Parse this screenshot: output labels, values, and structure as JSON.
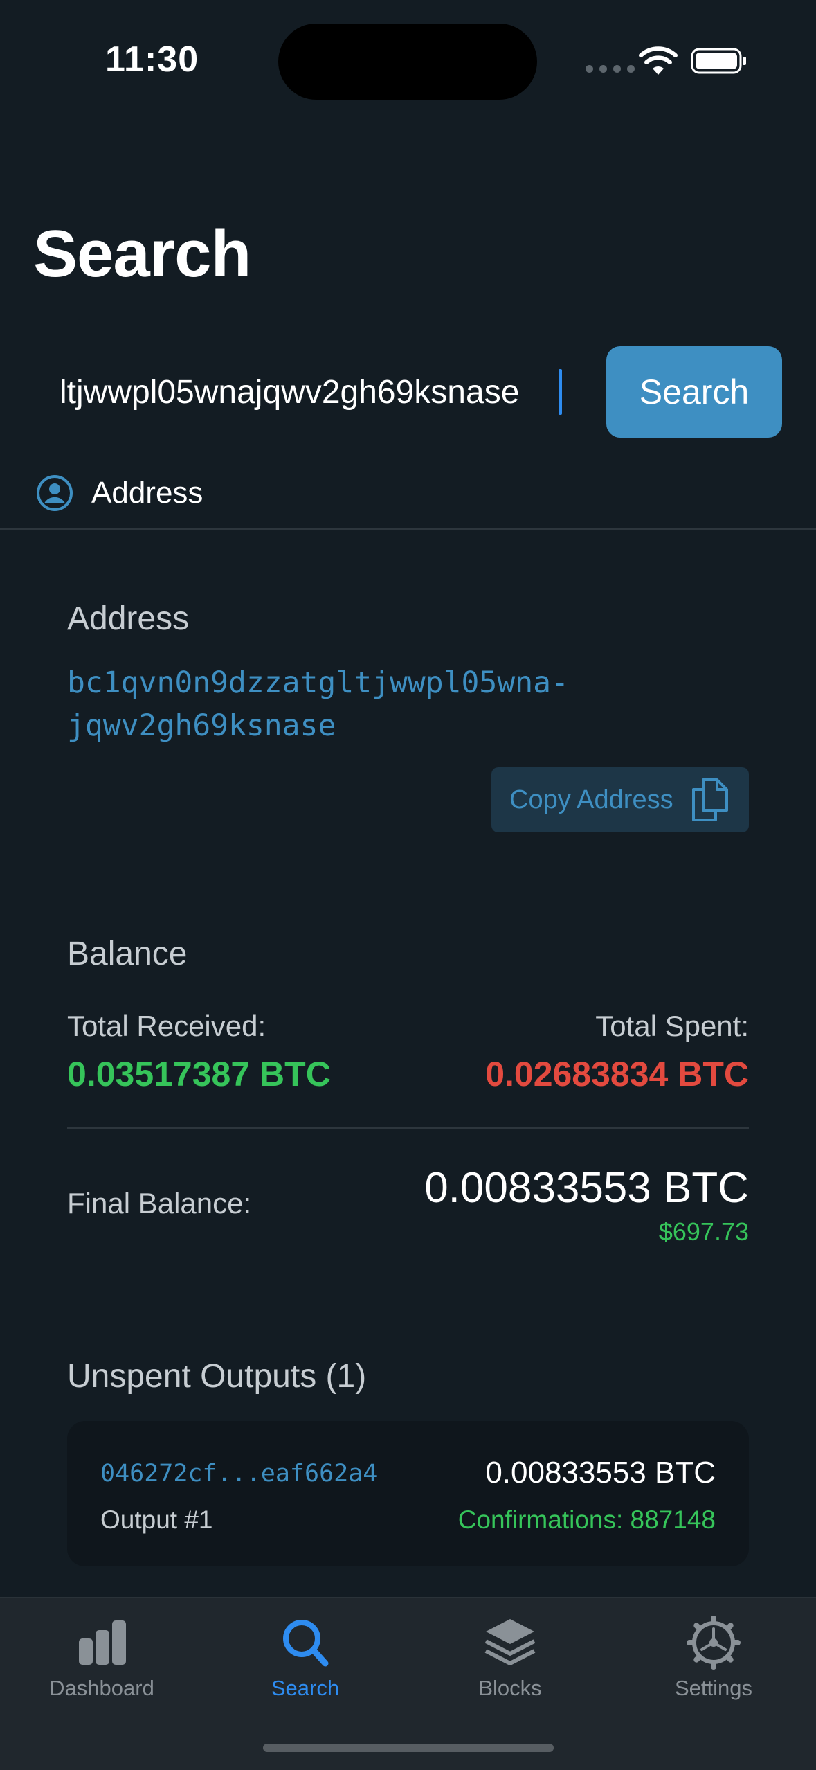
{
  "status_bar": {
    "time": "11:30"
  },
  "header": {
    "title": "Search"
  },
  "search": {
    "query": "ltjwwpl05wnajqwv2gh69ksnase",
    "button_label": "Search"
  },
  "result_type": {
    "icon": "person-circle-icon",
    "label": "Address"
  },
  "address_section": {
    "heading": "Address",
    "line1": "bc1qvn0n9dzzatgltjwwpl05wna-",
    "line2": "jqwv2gh69ksnase",
    "copy_label": "Copy Address",
    "copy_icon": "copy-icon"
  },
  "balance_section": {
    "heading": "Balance",
    "received_label": "Total Received:",
    "received_value": "0.03517387 BTC",
    "spent_label": "Total Spent:",
    "spent_value": "0.02683834 BTC",
    "final_label": "Final Balance:",
    "final_value": "0.00833553 BTC",
    "final_fiat": "$697.73"
  },
  "utxo_section": {
    "heading": "Unspent Outputs (1)",
    "items": [
      {
        "txid": "046272cf...eaf662a4",
        "amount": "0.00833553 BTC",
        "output": "Output #1",
        "confirmations": "Confirmations: 887148"
      }
    ]
  },
  "tab_bar": {
    "tabs": [
      {
        "label": "Dashboard",
        "icon": "bar-chart-icon",
        "active": false
      },
      {
        "label": "Search",
        "icon": "magnifier-icon",
        "active": true
      },
      {
        "label": "Blocks",
        "icon": "stack-icon",
        "active": false
      },
      {
        "label": "Settings",
        "icon": "gear-icon",
        "active": false
      }
    ]
  },
  "colors": {
    "background": "#131c23",
    "accent": "#3e8fc2",
    "active_tab": "#2e8cf0",
    "positive": "#36c45a",
    "negative": "#e34a3f"
  }
}
